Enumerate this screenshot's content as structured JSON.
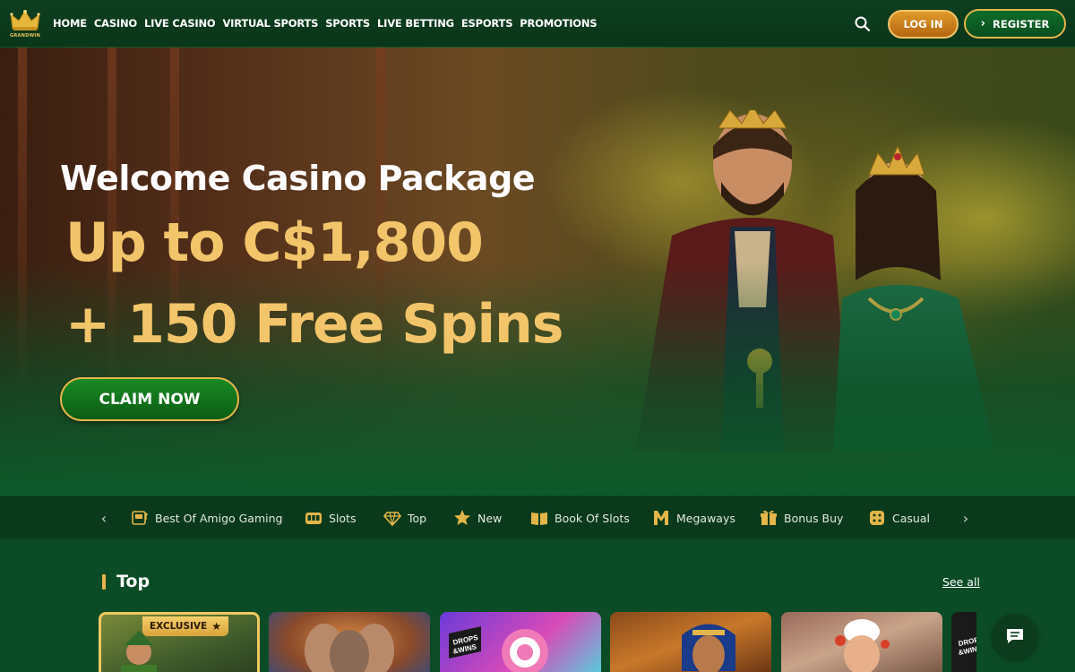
{
  "brand": {
    "logo_text": "GRANDWIN"
  },
  "nav": {
    "items": [
      {
        "label": "HOME"
      },
      {
        "label": "CASINO"
      },
      {
        "label": "LIVE CASINO"
      },
      {
        "label": "VIRTUAL SPORTS"
      },
      {
        "label": "SPORTS"
      },
      {
        "label": "LIVE BETTING"
      },
      {
        "label": "ESPORTS"
      },
      {
        "label": "PROMOTIONS"
      }
    ]
  },
  "auth": {
    "login_label": "LOG IN",
    "register_label": "REGISTER"
  },
  "hero": {
    "title": "Welcome Casino Package",
    "amount": "Up to C$1,800",
    "spins": "+ 150 Free Spins",
    "cta_label": "CLAIM NOW"
  },
  "categories": [
    {
      "label": "Best Of Amigo Gaming",
      "icon": "slot-machine-icon"
    },
    {
      "label": "Slots",
      "icon": "slots-icon"
    },
    {
      "label": "Top",
      "icon": "diamond-icon"
    },
    {
      "label": "New",
      "icon": "star-icon"
    },
    {
      "label": "Book Of Slots",
      "icon": "book-icon"
    },
    {
      "label": "Megaways",
      "icon": "megaways-icon"
    },
    {
      "label": "Bonus Buy",
      "icon": "gift-icon"
    },
    {
      "label": "Casual",
      "icon": "dice-icon"
    }
  ],
  "section": {
    "title": "Top",
    "see_all": "See all"
  },
  "tiles": [
    {
      "badge": "EXCLUSIVE"
    },
    {
      "badge": ""
    },
    {
      "badge": "DROPS & WINS"
    },
    {
      "badge": ""
    },
    {
      "badge": ""
    },
    {
      "badge": "DROPS & WINS"
    }
  ],
  "colors": {
    "accent_gold": "#f2c56a",
    "primary_green": "#0c5a2a",
    "header_green": "#0a3519",
    "login_orange": "#d08420"
  }
}
